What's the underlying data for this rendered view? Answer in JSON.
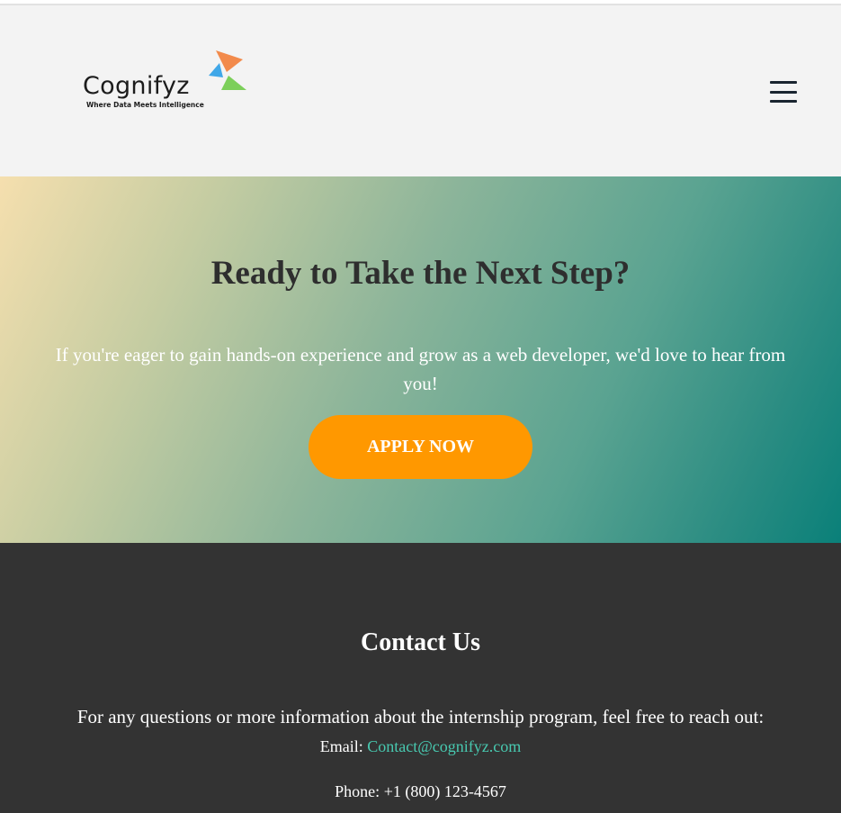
{
  "header": {
    "logo": {
      "name": "Cognifyz",
      "tagline": "Where Data Meets Intelligence",
      "colors": [
        "#f28a4b",
        "#3fa7e8",
        "#7ccf5a"
      ]
    },
    "menu_icon": "hamburger-menu-icon"
  },
  "hero": {
    "title": "Ready to Take the Next Step?",
    "text": "If you're eager to gain hands-on experience and grow as a web developer, we'd love to hear from you!",
    "button_label": "APPLY NOW",
    "button_color": "#ff9800"
  },
  "contact": {
    "title": "Contact Us",
    "intro": "For any questions or more information about the internship program, feel free to reach out:",
    "email_label": "Email:",
    "email": "Contact@cognifyz.com",
    "phone_label": "Phone:",
    "phone": "+1 (800) 123-4567"
  }
}
